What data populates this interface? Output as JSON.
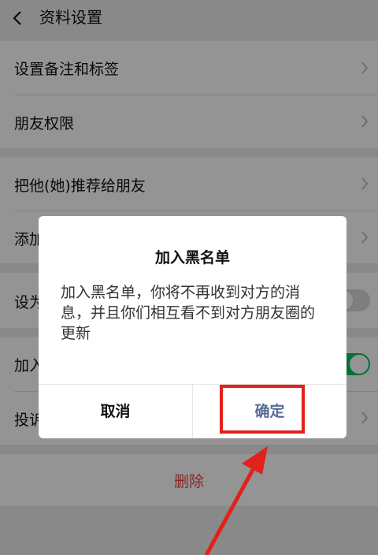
{
  "header": {
    "title": "资料设置",
    "back_icon": "chevron-left-icon"
  },
  "rows": [
    {
      "label": "设置备注和标签",
      "icon": "chevron-right-icon"
    },
    {
      "label": "朋友权限",
      "icon": "chevron-right-icon"
    },
    {
      "label": "把他(她)推荐给朋友",
      "icon": "chevron-right-icon"
    },
    {
      "label": "添加",
      "icon": "chevron-right-icon"
    },
    {
      "label": "设为",
      "toggle": "off"
    },
    {
      "label": "加入",
      "toggle": "on"
    },
    {
      "label": "投诉",
      "icon": "chevron-right-icon"
    }
  ],
  "delete_label": "删除",
  "dialog": {
    "title": "加入黑名单",
    "message": "加入黑名单，你将不再收到对方的消息，并且你们相互看不到对方朋友圈的更新",
    "cancel_label": "取消",
    "confirm_label": "确定"
  },
  "colors": {
    "accent_link": "#576b95",
    "delete_red": "#e64340",
    "toggle_on": "#07c160",
    "annotation_red": "#e0221b"
  }
}
